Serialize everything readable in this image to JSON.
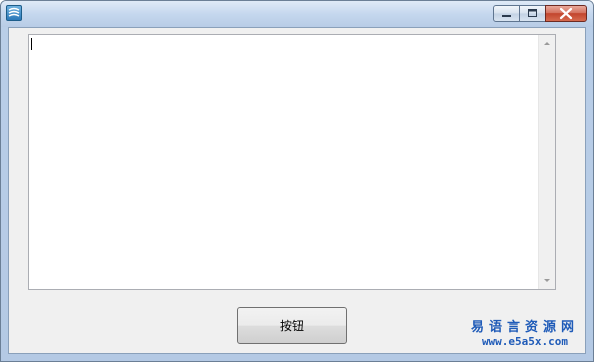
{
  "window": {
    "caption_buttons": [
      "minimize-icon",
      "maximize-icon",
      "close-icon"
    ],
    "close_color": "#c2452d",
    "accent": "#b9cee8"
  },
  "editor": {
    "value": ""
  },
  "action_button": {
    "label": "按钮"
  },
  "watermark": {
    "title": "易语言资源网",
    "url": "www.e5a5x.com",
    "color": "#1f5bb8"
  }
}
